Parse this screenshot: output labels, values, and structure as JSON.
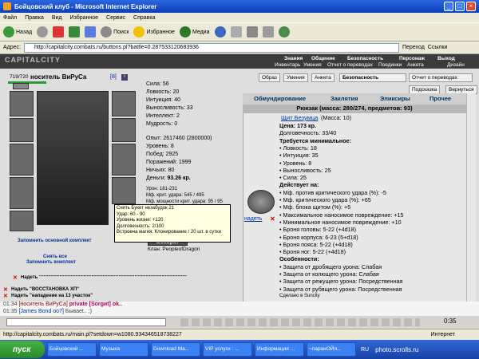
{
  "window": {
    "title": "Бойцовский клуб - Microsoft Internet Explorer"
  },
  "menu": [
    "Файл",
    "Правка",
    "Вид",
    "Избранное",
    "Сервис",
    "Справка"
  ],
  "toolbar": {
    "back": "Назад",
    "search": "Поиск",
    "favorites": "Избранное",
    "media": "Медиа"
  },
  "address": {
    "label": "Адрес:",
    "url": "http://capitalcity.combats.ru/buttons.pl?battle=0.287533120683936",
    "go": "Переход",
    "links": "Ссылки"
  },
  "game": {
    "logo": "CAPITALCITY",
    "nav1": [
      "Знания",
      "Общение",
      "Безопасность",
      "Персонаж",
      "Выход"
    ],
    "nav2": [
      "Инвентарь",
      "Умения",
      "Отчет о переводах",
      "Поединки",
      "Анкета",
      "Дизайн"
    ]
  },
  "char": {
    "hp": "719/720",
    "name": "носитель ВиРуСа",
    "level": "[8]",
    "stats": [
      {
        "k": "Сила:",
        "v": "56"
      },
      {
        "k": "Ловкость:",
        "v": "20"
      },
      {
        "k": "Интуиция:",
        "v": "40"
      },
      {
        "k": "Выносливость:",
        "v": "33"
      },
      {
        "k": "Интеллект:",
        "v": "2"
      },
      {
        "k": "Мудрость:",
        "v": "0"
      }
    ],
    "exp": [
      {
        "k": "Опыт:",
        "v": "2617460 (2800000)"
      },
      {
        "k": "Уровень:",
        "v": "8"
      },
      {
        "k": "Побед:",
        "v": "2925"
      },
      {
        "k": "Поражений:",
        "v": "1999"
      },
      {
        "k": "Ничьих:",
        "v": "80"
      },
      {
        "k": "Деньги:",
        "v": "93.26 кр."
      }
    ],
    "dmg": [
      "Урон: 181-231",
      "Мф. крит. удара: 545 / 495",
      "Мф. мощности крит. удара: 95 / 95"
    ],
    "clan": "Клан: PeopleofDragon",
    "return_btn": "Возврат"
  },
  "tooltip": [
    "Снять Букет незабудок 21",
    "Удар: 60 - 90",
    "Уровень жизни: +120",
    "Долговечность: 2/100",
    "Встроена магия: Клонирование / 20 шт. в сутки"
  ],
  "left_links": {
    "save_set": "Запомнить основной комплект",
    "remove_all": "Снять все",
    "save_set2": "Запомнить комплект"
  },
  "sets": [
    "Надеть \"\"\"\"\"\"\"\"\"\"\"\"\"\"\"\"\"\"\"\"\"\"\"\"\"\"\"\"\"\"\"\"\"\"\"\"\"\"\"\"\"\"\"\"\"\"\"\"\"\"\"\"\"\"\"\"\"\"\"\"\"\"\"\"\"",
    "Надеть \"ВОССТАНОВКА ХП\"",
    "Надеть \"нападение на 13 участок\""
  ],
  "rtabs": [
    "Образ",
    "Умения",
    "Анкета",
    "Безопасность",
    "Отчет о переводах"
  ],
  "rtabs2": [
    "Подсказка",
    "Вернуться"
  ],
  "shoptabs": [
    "Обмундирование",
    "Заклятия",
    "Эликсиры",
    "Прочее"
  ],
  "backpack": "Рюкзак (масса: 280/274, предметов: 93)",
  "item": {
    "name": "Щит Безумца",
    "mass": "(Масса: 10)",
    "wear": "надеть",
    "lines": [
      {
        "t": "Цена: 173 кр.",
        "b": true
      },
      {
        "t": "Долговечность: 33/40",
        "b": false
      },
      {
        "t": "Требуется минимальное:",
        "b": true
      },
      {
        "t": "• Ловкость: 18",
        "b": false
      },
      {
        "t": "• Интуиция: 35",
        "b": false
      },
      {
        "t": "• Уровень: 8",
        "b": false
      },
      {
        "t": "• Выносливость: 25",
        "b": false
      },
      {
        "t": "• Сила: 25",
        "b": false
      },
      {
        "t": "Действует на:",
        "b": true
      },
      {
        "t": "• Мф. против критического удара (%): -5",
        "b": false
      },
      {
        "t": "• Мф. критического удара (%): +65",
        "b": false
      },
      {
        "t": "• Мф. блока щитом (%): +5",
        "b": false
      },
      {
        "t": "• Максимальное наносимое повреждение: +15",
        "b": false
      },
      {
        "t": "• Минимальное наносимое повреждение: +10",
        "b": false
      },
      {
        "t": "• Броня головы: 5-22 (+4d18)",
        "b": false
      },
      {
        "t": "• Броня корпуса: 6-23 (5+d18)",
        "b": false
      },
      {
        "t": "• Броня пояса: 5-22 (+4d18)",
        "b": false
      },
      {
        "t": "• Броня ног: 5-22 (+4d18)",
        "b": false
      },
      {
        "t": "Особенности:",
        "b": true
      },
      {
        "t": "• Защита от дробящего урона: Слабая",
        "b": false
      },
      {
        "t": "• Защита от колющего урона: Слабая",
        "b": false
      },
      {
        "t": "• Защита от режущего урона: Посредственная",
        "b": false
      },
      {
        "t": "• Защита от рубящего урона: Посредственная",
        "b": false
      },
      {
        "t": "Сделано в Suncity",
        "b": false
      }
    ]
  },
  "chat": [
    {
      "time": "01:34",
      "who": "[носитель ВиРуСа]",
      "rest": "private [Sorgиt] ok.."
    },
    {
      "time": "01:35",
      "who": "[James Bond oo7]",
      "rest": "Бываеt.. ;)"
    }
  ],
  "chat_clock": "0:35",
  "status": {
    "url": "http://capitalcity.combats.ru/main.pl?setdown=w1080.934346518738227",
    "zone": "Интернет"
  },
  "taskbar": {
    "start": "пуск",
    "tasks": [
      "Бойцовский ...",
      "Музыка",
      "Download Ma...",
      "VIP услуги : ...",
      "Информация ...",
      "~паранОЙя..."
    ],
    "lang": "RU",
    "tray": "photo.scrolls.ru"
  }
}
